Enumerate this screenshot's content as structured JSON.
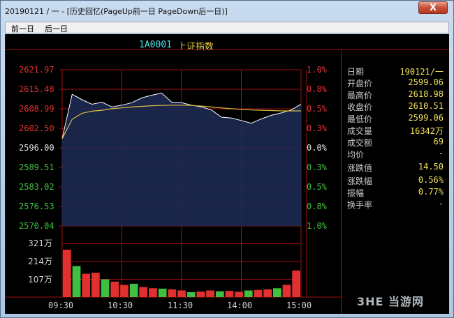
{
  "window": {
    "title": "20190121 / 一 - [历史回忆(PageUp前一日 PageDown后一日)]",
    "close_glyph": "X",
    "accent": "#2a5d9a"
  },
  "menu": {
    "items": [
      "前一日",
      "后一日"
    ]
  },
  "stock": {
    "code": "1A0001",
    "name": "上证指数"
  },
  "chart": {
    "price_labels": [
      "2621.97",
      "2615.48",
      "2608.99",
      "2602.50",
      "2596.00",
      "2589.51",
      "2583.02",
      "2576.53",
      "2570.04"
    ],
    "pct_labels": [
      "1.0%",
      "0.8%",
      "0.5%",
      "0.3%",
      "0.0%",
      "0.3%",
      "0.5%",
      "0.8%",
      "1.0%"
    ],
    "volume_labels": [
      "321万",
      "214万",
      "107万"
    ],
    "time_labels": [
      "09:30",
      "10:30",
      "11:30",
      "14:00",
      "15:00"
    ],
    "colors": {
      "up": "#e03030",
      "down": "#40c040",
      "flat": "#e0e0e0",
      "grid": "#a01010",
      "price_line": "#ffffff",
      "avg_line": "#e0c040"
    }
  },
  "chart_data": {
    "type": "line",
    "xlabel": "",
    "ylabel": "",
    "ylim": [
      2570.04,
      2621.97
    ],
    "y2lim": [
      -1.0,
      1.0
    ],
    "x": [
      "09:30",
      "09:40",
      "09:50",
      "10:00",
      "10:10",
      "10:20",
      "10:30",
      "10:40",
      "10:50",
      "11:00",
      "11:10",
      "11:20",
      "11:30",
      "13:10",
      "13:20",
      "13:30",
      "13:40",
      "13:50",
      "14:00",
      "14:10",
      "14:20",
      "14:30",
      "14:40",
      "14:50",
      "15:00"
    ],
    "series": [
      {
        "values": [
          2599.06,
          2613.8,
          2612.0,
          2610.5,
          2611.2,
          2609.6,
          2610.2,
          2611.0,
          2612.6,
          2613.5,
          2614.2,
          2611.2,
          2611.0,
          2610.2,
          2609.6,
          2608.6,
          2606.2,
          2605.9,
          2605.1,
          2604.2,
          2605.6,
          2606.8,
          2607.6,
          2608.6,
          2610.51
        ]
      },
      {
        "values": [
          2599.06,
          2605.5,
          2607.5,
          2608.2,
          2608.5,
          2609.0,
          2609.3,
          2609.6,
          2609.8,
          2610.0,
          2610.1,
          2610.2,
          2610.2,
          2610.1,
          2609.9,
          2609.6,
          2609.3,
          2609.0,
          2608.8,
          2608.6,
          2608.5,
          2608.4,
          2608.3,
          2608.3,
          2608.3
        ]
      }
    ],
    "volume": {
      "ylim": [
        0,
        321
      ],
      "unit": "万",
      "values": [
        214,
        140,
        105,
        110,
        80,
        70,
        55,
        60,
        45,
        40,
        38,
        35,
        30,
        22,
        25,
        30,
        26,
        28,
        24,
        30,
        32,
        35,
        40,
        55,
        120
      ]
    },
    "grid": true
  },
  "panel": {
    "rows": [
      {
        "k": "日期",
        "v": "190121/一"
      },
      {
        "k": "开盘价",
        "v": "2599.06"
      },
      {
        "k": "最高价",
        "v": "2618.98"
      },
      {
        "k": "收盘价",
        "v": "2610.51"
      },
      {
        "k": "最低价",
        "v": "2599.06"
      },
      {
        "k": "成交量",
        "v": "16342万"
      },
      {
        "k": "成交额",
        "v": "69"
      },
      {
        "k": "均价",
        "v": "-"
      },
      {
        "k": "涨跌值",
        "v": "14.50"
      },
      {
        "k": "涨跌幅",
        "v": "0.56%"
      },
      {
        "k": "振幅",
        "v": "0.77%"
      },
      {
        "k": "换手率",
        "v": "-"
      }
    ]
  },
  "watermark": {
    "text": "3HE 当游网"
  }
}
